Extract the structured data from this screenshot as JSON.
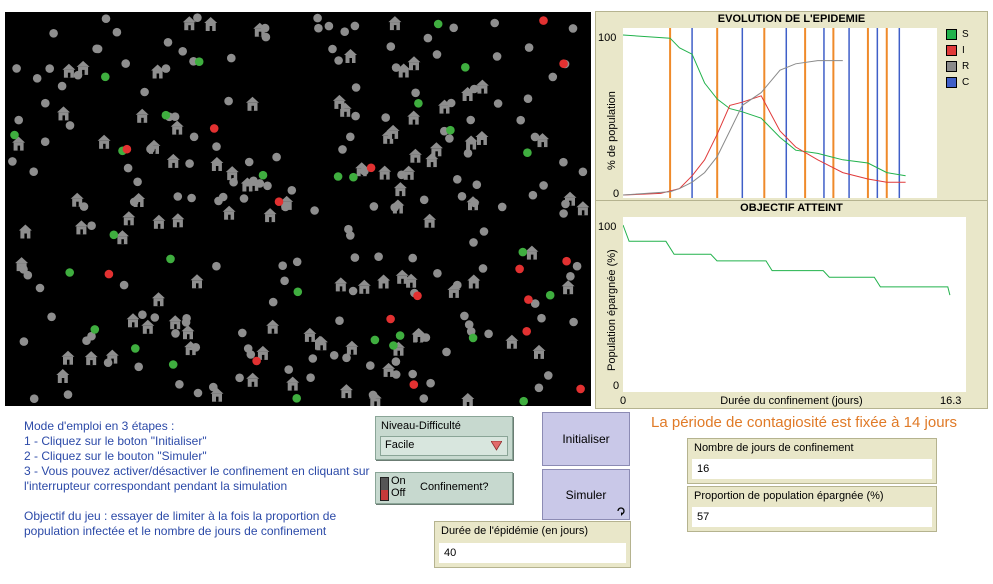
{
  "plot_epidemic": {
    "title": "EVOLUTION DE L'EPIDEMIE",
    "ylabel": "% de population",
    "y_max_tick": "100",
    "y_min_tick": "0",
    "legend": [
      {
        "label": "S",
        "color": "#22b24c"
      },
      {
        "label": "I",
        "color": "#e03a3a"
      },
      {
        "label": "R",
        "color": "#8a8a8a"
      },
      {
        "label": "C",
        "color": "#3f5fc8"
      }
    ]
  },
  "plot_objectif": {
    "title": "OBJECTIF ATTEINT",
    "ylabel": "Population épargnée (%)",
    "xlabel": "Durée du confinement (jours)",
    "y_max_tick": "100",
    "y_min_tick": "0",
    "x_min_tick": "0",
    "x_max_tick": "16.3"
  },
  "chart_data": [
    {
      "type": "line",
      "title": "EVOLUTION DE L'EPIDEMIE",
      "ylabel": "% de population",
      "ylim": [
        0,
        100
      ],
      "series": [
        {
          "name": "S",
          "color": "#22b24c",
          "x": [
            0,
            15,
            18,
            22,
            26,
            30,
            34,
            38,
            44,
            50,
            55,
            62,
            66,
            70,
            78,
            84,
            90
          ],
          "y": [
            100,
            98,
            92,
            88,
            70,
            60,
            54,
            52,
            48,
            36,
            28,
            26,
            24,
            22,
            20,
            14,
            12
          ]
        },
        {
          "name": "I",
          "color": "#e03a3a",
          "x": [
            0,
            12,
            18,
            22,
            26,
            30,
            34,
            38,
            44,
            50,
            55,
            62,
            66,
            70,
            78,
            84,
            90
          ],
          "y": [
            0,
            1,
            4,
            12,
            22,
            38,
            56,
            58,
            62,
            40,
            30,
            22,
            18,
            14,
            10,
            8,
            8
          ]
        },
        {
          "name": "R",
          "color": "#8a8a8a",
          "x": [
            0,
            15,
            18,
            22,
            26,
            30,
            34,
            38,
            44,
            50,
            55,
            62,
            66,
            70
          ],
          "y": [
            0,
            2,
            4,
            8,
            14,
            24,
            40,
            56,
            64,
            78,
            82,
            84,
            84,
            84
          ]
        }
      ],
      "confinement_switches": {
        "name": "C",
        "color": "#3f5fc8",
        "orange_positions": [
          15,
          30,
          45,
          58,
          67,
          78,
          84
        ],
        "blue_positions": [
          22,
          38,
          52,
          64,
          72,
          81,
          88
        ]
      }
    },
    {
      "type": "line",
      "title": "OBJECTIF ATTEINT",
      "xlabel": "Durée du confinement (jours)",
      "ylabel": "Population épargnée (%)",
      "xlim": [
        0,
        16.3
      ],
      "ylim": [
        0,
        100
      ],
      "series": [
        {
          "name": "",
          "color": "#22b24c",
          "x": [
            0,
            0.3,
            2.1,
            2.5,
            4.3,
            4.6,
            7.0,
            7.3,
            9.8,
            10.1,
            12.3,
            12.6,
            15.9,
            16.0
          ],
          "y": [
            100,
            90,
            90,
            82,
            82,
            78,
            78,
            72,
            72,
            68,
            68,
            62,
            62,
            57
          ]
        }
      ]
    }
  ],
  "instructions": [
    "Mode d'emploi en 3 étapes :",
    "1 - Cliquez sur le boton \"Initialiser\"",
    "2 - Cliquez sur le bouton \"Simuler\"",
    "3 - Vous pouvez activer/désactiver le confinement en cliquant sur l'interrupteur correspondant pendant la simulation",
    "",
    "Objectif du jeu : essayer de limiter à la fois la proportion de population infectée et le nombre de jours de confinement"
  ],
  "chooser": {
    "label": "Niveau-Difficulté",
    "value": "Facile"
  },
  "switch": {
    "on_label": "On",
    "off_label": "Off",
    "label": "Confinement?"
  },
  "buttons": {
    "initialiser": "Initialiser",
    "simuler": "Simuler"
  },
  "monitors": {
    "duree_label": "Durée de l'épidémie (en jours)",
    "duree_value": "40",
    "jours_label": "Nombre de jours de confinement",
    "jours_value": "16",
    "proportion_label": "Proportion de population épargnée (%)",
    "proportion_value": "57"
  },
  "note": "La période de contagiosité est fixée à 14 jours",
  "world_colors": {
    "background": "#000000",
    "house": "#8e8e8e",
    "healthy": "#8e8e8e",
    "susceptible": "#3fae3f",
    "infected": "#e23131"
  }
}
